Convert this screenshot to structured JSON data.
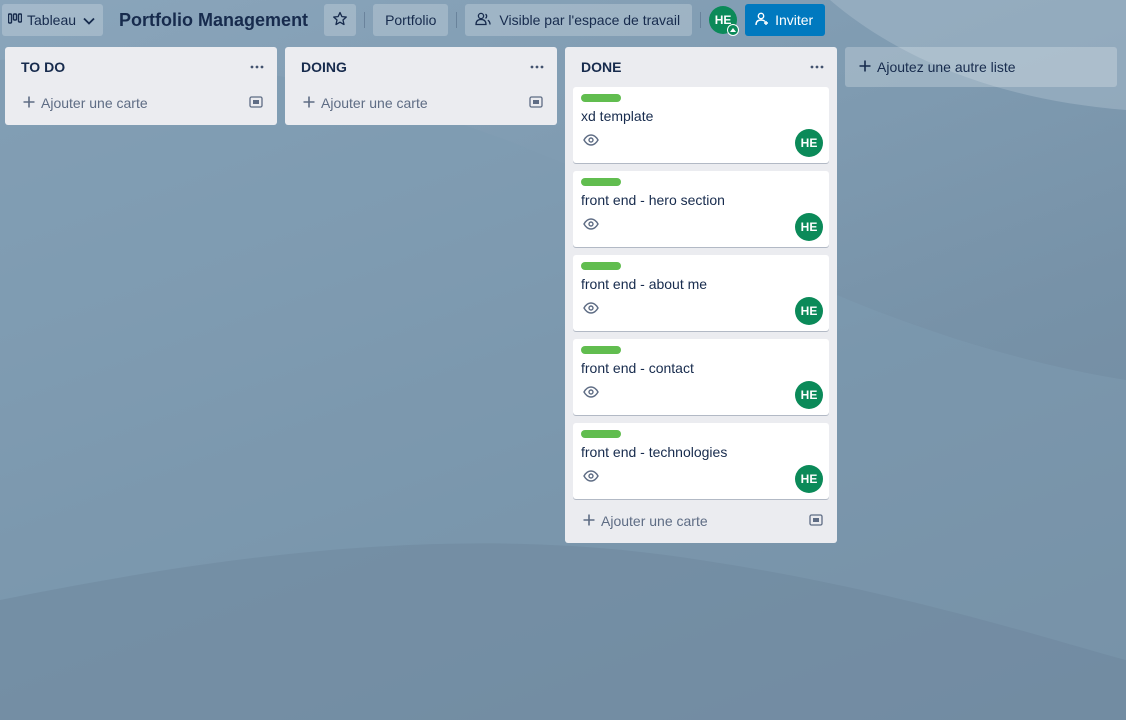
{
  "header": {
    "view_label": "Tableau",
    "board_title": "Portfolio Management",
    "workspace_label": "Portfolio",
    "visibility_label": "Visible par l'espace de travail",
    "member_initials": "HE",
    "invite_label": "Inviter"
  },
  "lists": [
    {
      "title": "TO DO",
      "add_card_label": "Ajouter une carte",
      "cards": []
    },
    {
      "title": "DOING",
      "add_card_label": "Ajouter une carte",
      "cards": []
    },
    {
      "title": "DONE",
      "add_card_label": "Ajouter une carte",
      "cards": [
        {
          "title": "xd template",
          "label_color": "#61bd4f",
          "member": "HE"
        },
        {
          "title": "front end - hero section",
          "label_color": "#61bd4f",
          "member": "HE"
        },
        {
          "title": "front end - about me",
          "label_color": "#61bd4f",
          "member": "HE"
        },
        {
          "title": "front end - contact",
          "label_color": "#61bd4f",
          "member": "HE"
        },
        {
          "title": "front end - technologies",
          "label_color": "#61bd4f",
          "member": "HE"
        }
      ]
    }
  ],
  "add_list_label": "Ajoutez une autre liste",
  "colors": {
    "label_green": "#61bd4f",
    "avatar_green": "#0b8a59",
    "invite_blue": "#0079bf",
    "list_bg": "#ebecf0"
  },
  "icons": {
    "view": "board-view-icon",
    "chevron": "chevron-down-icon",
    "star": "star-icon",
    "visibility": "workspace-visibility-icon",
    "invite": "add-person-icon",
    "list_menu": "more-options-icon",
    "add": "plus-icon",
    "template": "card-template-icon",
    "watch": "eye-icon"
  }
}
